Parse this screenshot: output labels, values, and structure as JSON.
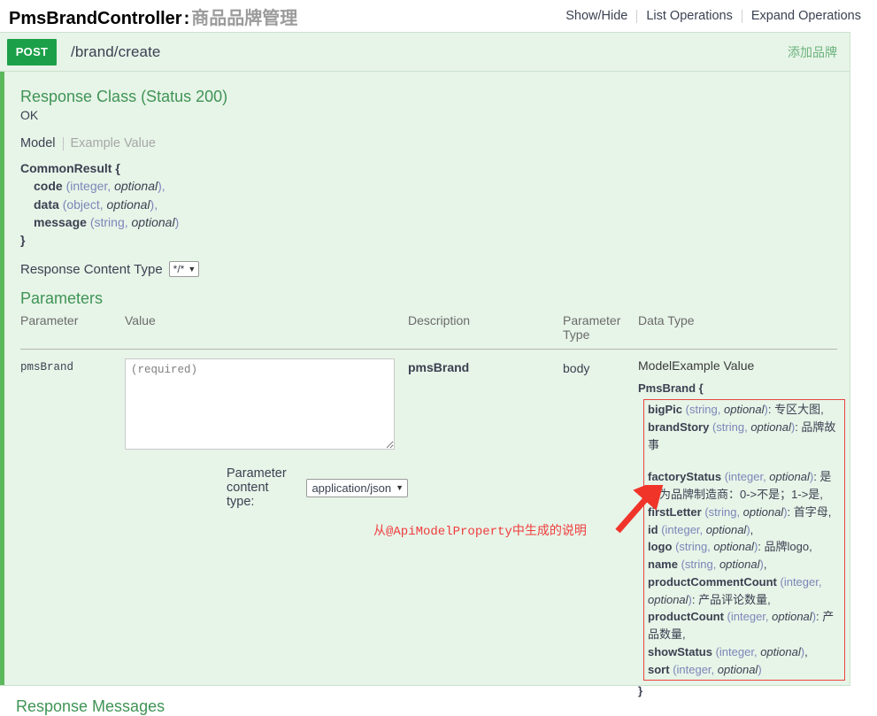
{
  "resource": {
    "controller": "PmsBrandController",
    "separator": ":",
    "description": "商品品牌管理",
    "options": [
      {
        "label": "Show/Hide"
      },
      {
        "label": "List Operations"
      },
      {
        "label": "Expand Operations"
      }
    ]
  },
  "operation": {
    "method": "POST",
    "path": "/brand/create",
    "summary": "添加品牌"
  },
  "response_class": {
    "title": "Response Class (Status 200)",
    "status_text": "OK",
    "tabs": {
      "model": "Model",
      "example": "Example Value"
    },
    "model": {
      "name": "CommonResult {",
      "close": "}",
      "properties": [
        {
          "name": "code",
          "type": "(integer, ",
          "optional": "optional",
          "tail": "),",
          "desc": ""
        },
        {
          "name": "data",
          "type": "(object, ",
          "optional": "optional",
          "tail": "),",
          "desc": ""
        },
        {
          "name": "message",
          "type": "(string, ",
          "optional": "optional",
          "tail": ")",
          "desc": ""
        }
      ]
    }
  },
  "response_content_type": {
    "label": "Response Content Type",
    "value": "*/*",
    "caret": "chevron-down-icon"
  },
  "parameters": {
    "title": "Parameters",
    "columns": {
      "parameter": "Parameter",
      "value": "Value",
      "description": "Description",
      "parameter_type": "Parameter\nType",
      "parameter_type_line1": "Parameter",
      "parameter_type_line2": "Type",
      "data_type": "Data Type"
    },
    "row": {
      "parameter": "pmsBrand",
      "value_placeholder": "(required)",
      "value": "",
      "description": "pmsBrand",
      "parameter_type": "body",
      "content_type_label": "Parameter content type:",
      "content_type_value": "application/json"
    },
    "data_type": {
      "tabs": {
        "model": "Model",
        "example": "Example Value"
      },
      "model_name": "PmsBrand {",
      "model_close": "}",
      "properties": [
        {
          "name": "bigPic",
          "type": "(string, ",
          "optional": "optional",
          "tail": ")",
          "desc": ": 专区大图,"
        },
        {
          "name": "brandStory",
          "type": "(string, ",
          "optional": "optional",
          "tail": ")",
          "desc": ": 品牌故事"
        },
        {
          "name": "",
          "type": "",
          "optional": "",
          "tail": "",
          "desc": "",
          "blank": true
        },
        {
          "name": "factoryStatus",
          "type": "(integer, ",
          "optional": "optional",
          "tail": ")",
          "desc": ": 是否为品牌制造商：0->不是；1->是,"
        },
        {
          "name": "firstLetter",
          "type": "(string, ",
          "optional": "optional",
          "tail": ")",
          "desc": ": 首字母,"
        },
        {
          "name": "id",
          "type": "(integer, ",
          "optional": "optional",
          "tail": ")",
          "desc": ","
        },
        {
          "name": "logo",
          "type": "(string, ",
          "optional": "optional",
          "tail": ")",
          "desc": ": 品牌logo,"
        },
        {
          "name": "name",
          "type": "(string, ",
          "optional": "optional",
          "tail": ")",
          "desc": ","
        },
        {
          "name": "productCommentCount",
          "type": "(integer, ",
          "optional": "optional",
          "tail": ")",
          "desc": ": 产品评论数量,"
        },
        {
          "name": "productCount",
          "type": "(integer, ",
          "optional": "optional",
          "tail": ")",
          "desc": ": 产品数量,"
        },
        {
          "name": "showStatus",
          "type": "(integer, ",
          "optional": "optional",
          "tail": ")",
          "desc": ","
        },
        {
          "name": "sort",
          "type": "(integer, ",
          "optional": "optional",
          "tail": ")",
          "desc": ""
        }
      ]
    }
  },
  "annotation": {
    "text": "从@ApiModelProperty中生成的说明",
    "color": "#ef3d3d",
    "arrow": "red-arrow-icon"
  },
  "response_messages": {
    "title": "Response Messages"
  },
  "colors": {
    "method_post": "#1ba049",
    "panel_bg": "#e7f4e8",
    "accent_green": "#3f9455",
    "left_border": "#5cb85c",
    "annotation_red": "#ef3d3d",
    "box_red": "#e8453c"
  }
}
